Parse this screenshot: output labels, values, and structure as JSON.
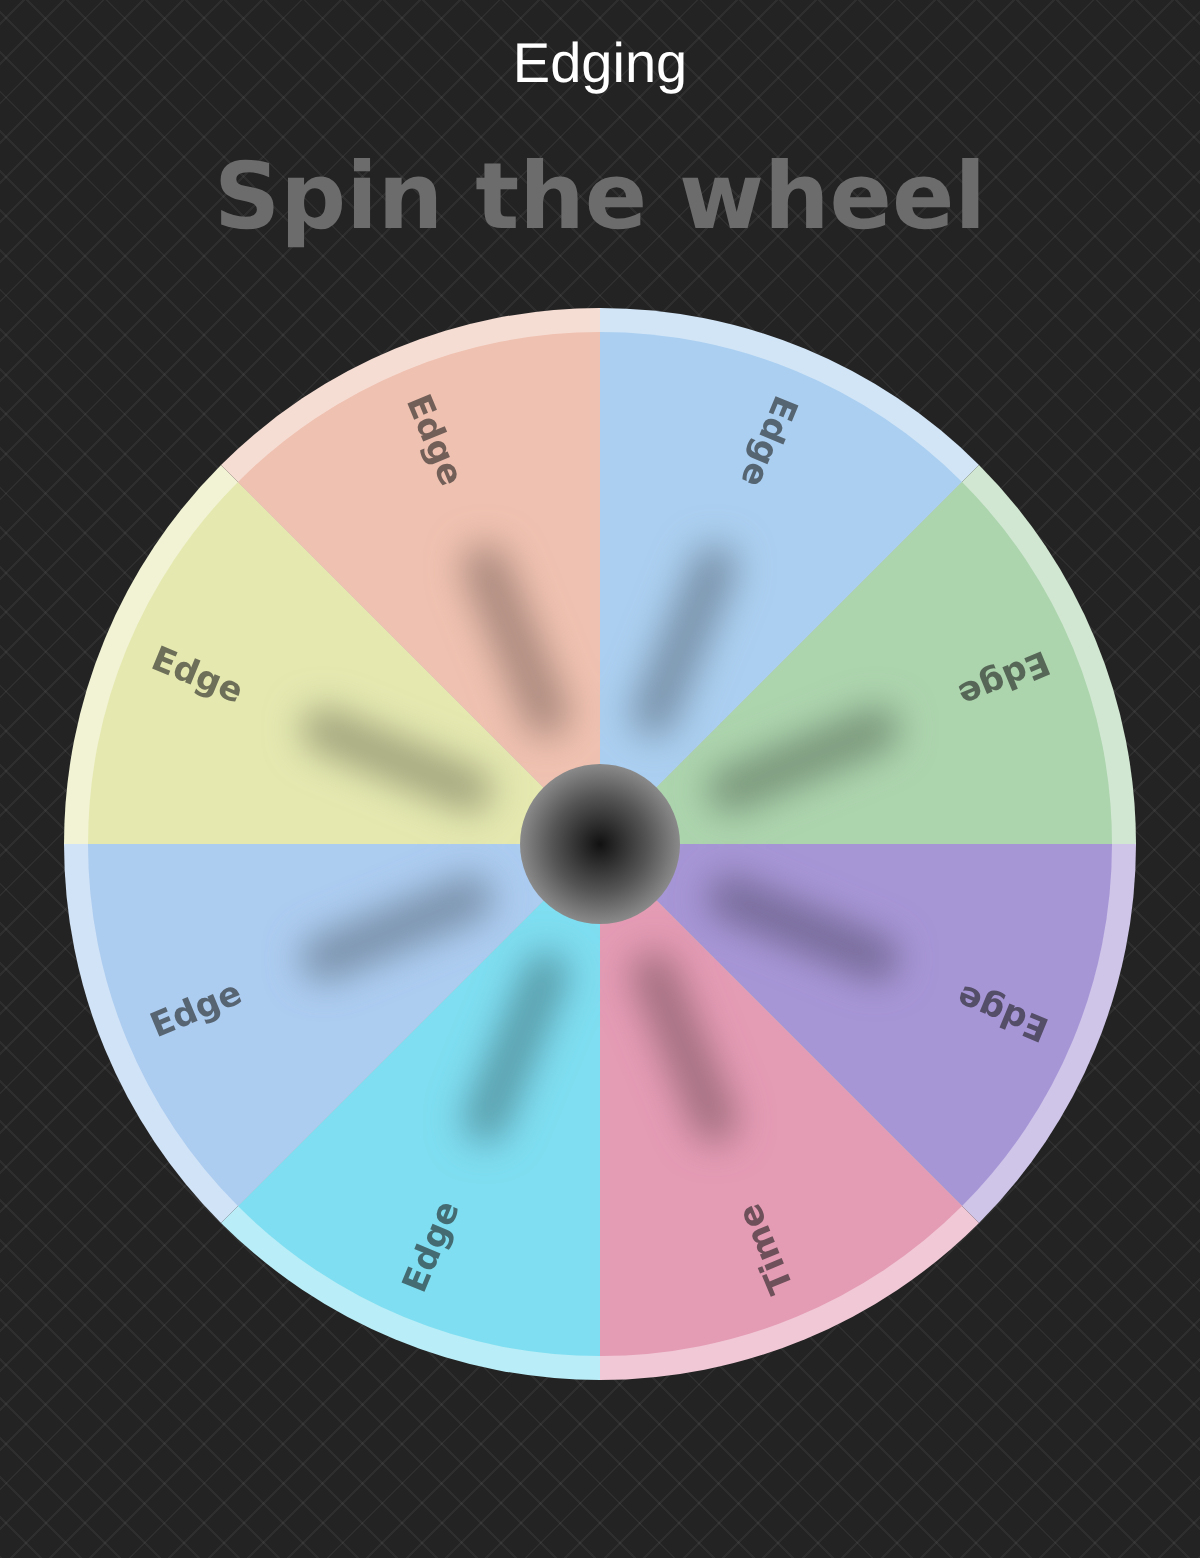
{
  "title": "Edging",
  "heading": "Spin the wheel",
  "wheel": {
    "segments": [
      {
        "label": "Edge",
        "color": "#abcff0"
      },
      {
        "label": "Edge",
        "color": "#acd4ad"
      },
      {
        "label": "Edge",
        "color": "#a796d6"
      },
      {
        "label": "Time",
        "color": "#e49bb4"
      },
      {
        "label": "Edge",
        "color": "#7fdef1"
      },
      {
        "label": "Edge",
        "color": "#acccf0"
      },
      {
        "label": "Edge",
        "color": "#e5e9b0"
      },
      {
        "label": "Edge",
        "color": "#efc1b0"
      }
    ]
  }
}
